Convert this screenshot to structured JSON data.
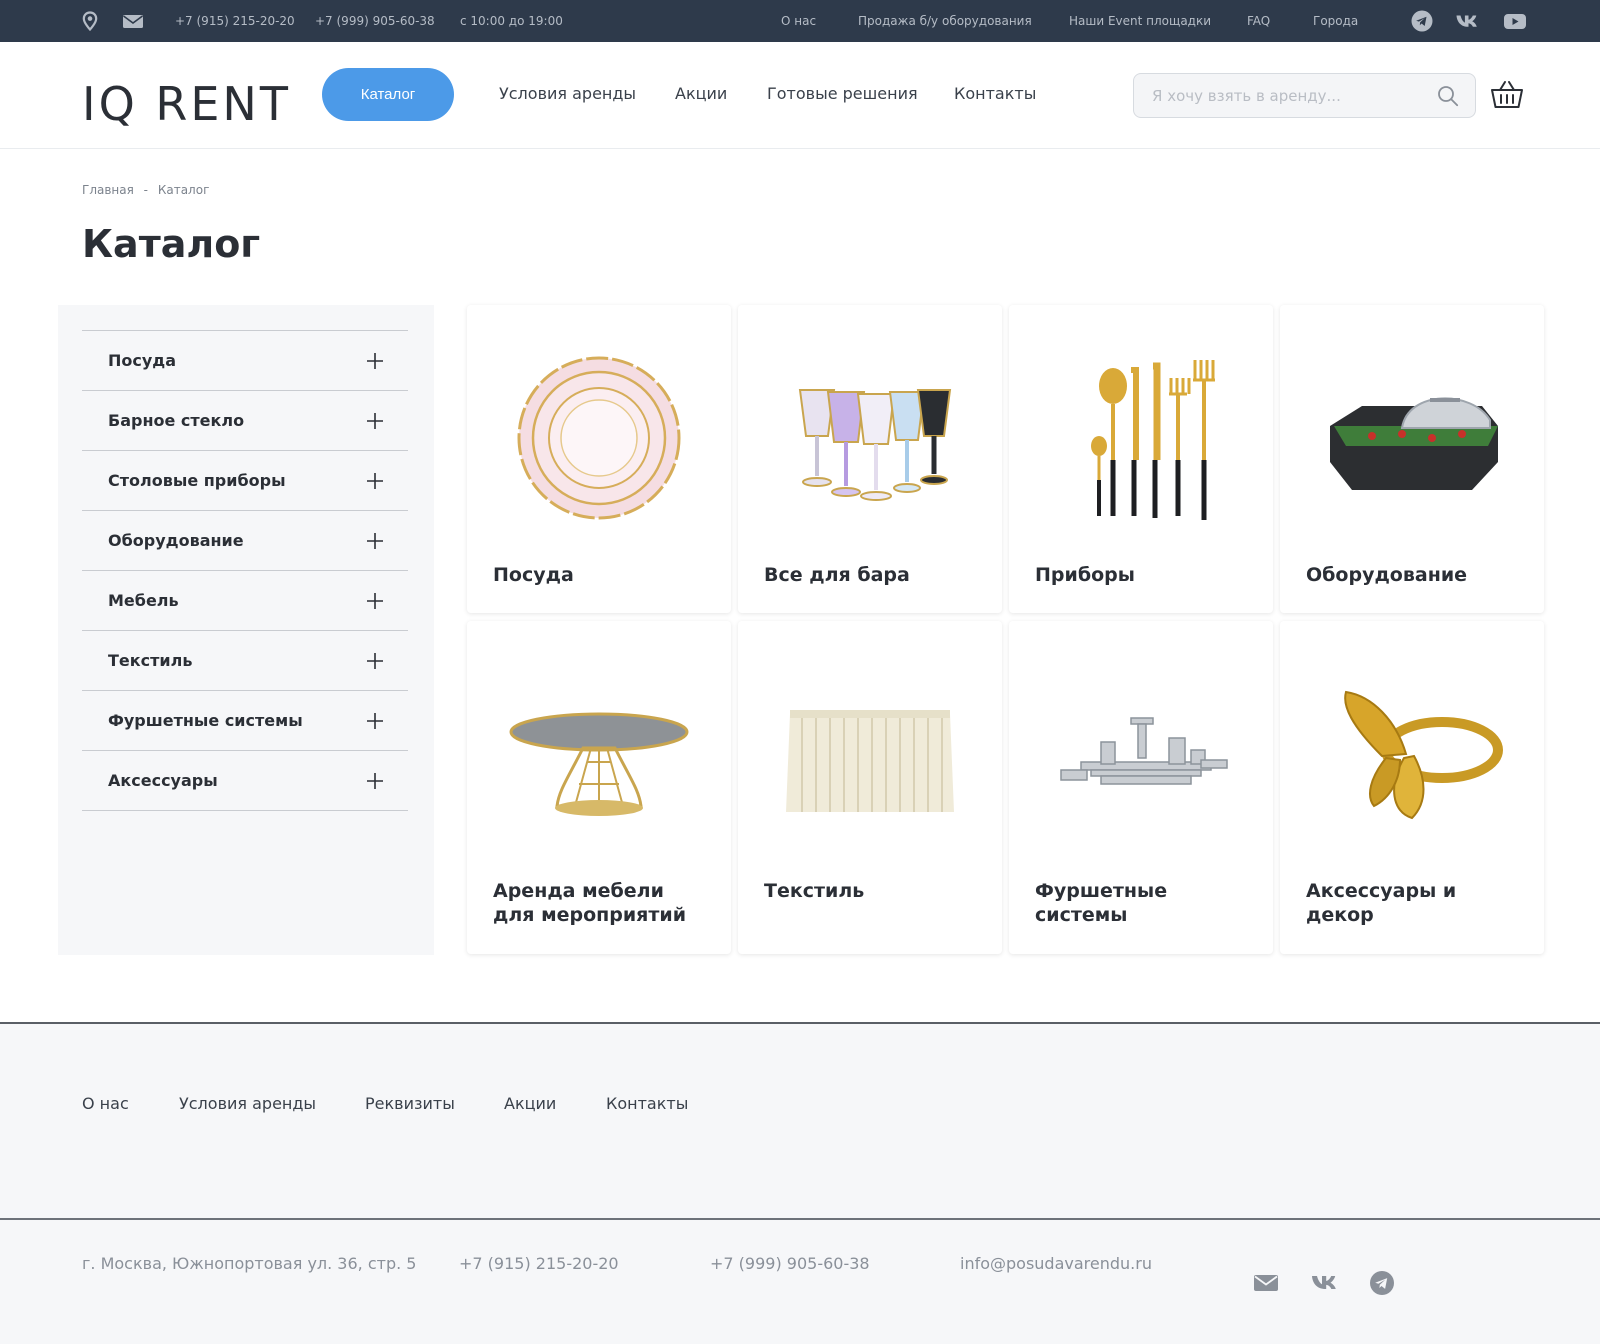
{
  "topbar": {
    "phone1": "+7 (915) 215-20-20",
    "phone2": "+7 (999) 905-60-38",
    "hours": "с 10:00 до 19:00",
    "links": [
      "О нас",
      "Продажа б/у оборудования",
      "Наши Event площадки",
      "FAQ",
      "Города"
    ],
    "icons": [
      "map-pin-icon",
      "mail-icon",
      "telegram-icon",
      "vk-icon",
      "youtube-icon"
    ]
  },
  "header": {
    "logo": "IQ RENT",
    "catalog_button": "Каталог",
    "nav": [
      "Условия аренды",
      "Акции",
      "Готовые решения",
      "Контакты"
    ],
    "search_placeholder": "Я хочу взять в аренду...",
    "icons": [
      "search-icon",
      "basket-icon"
    ]
  },
  "breadcrumb": {
    "home": "Главная",
    "separator": "-",
    "current": "Каталог"
  },
  "page_title": "Каталог",
  "sidebar": {
    "items": [
      {
        "label": "Посуда"
      },
      {
        "label": "Барное стекло"
      },
      {
        "label": "Столовые приборы"
      },
      {
        "label": "Оборудование"
      },
      {
        "label": "Мебель"
      },
      {
        "label": "Текстиль"
      },
      {
        "label": "Фуршетные системы"
      },
      {
        "label": "Аксессуары"
      }
    ]
  },
  "cards": [
    {
      "title": "Посуда",
      "image": "plate"
    },
    {
      "title": "Все для бара",
      "image": "glasses"
    },
    {
      "title": "Приборы",
      "image": "cutlery"
    },
    {
      "title": "Оборудование",
      "image": "chafing-dish"
    },
    {
      "title": "Аренда мебели для мероприятий",
      "image": "table"
    },
    {
      "title": "Текстиль",
      "image": "table-skirt"
    },
    {
      "title": "Фуршетные системы",
      "image": "buffet-stands"
    },
    {
      "title": "Аксессуары и декор",
      "image": "napkin-ring"
    }
  ],
  "footer": {
    "nav": [
      "О нас",
      "Условия аренды",
      "Реквизиты",
      "Акции",
      "Контакты"
    ],
    "address": "г. Москва, Южнопортовая ул. 36, стр. 5",
    "phone1": "+7 (915) 215-20-20",
    "phone2": "+7 (999) 905-60-38",
    "email": "info@posudavarendu.ru",
    "icons": [
      "mail-icon",
      "vk-icon",
      "telegram-icon"
    ]
  },
  "colors": {
    "topbar_bg": "#2e3a4b",
    "accent": "#4c9ae8",
    "text_dark": "#2b2f36",
    "sidebar_bg": "#f6f7f9"
  }
}
